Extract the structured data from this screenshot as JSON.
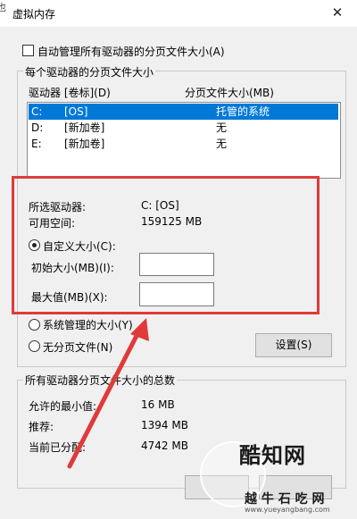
{
  "window": {
    "title": "虚拟内存",
    "close_glyph": "✕",
    "left_edge_char": "也"
  },
  "auto_manage": {
    "label": "自动管理所有驱动器的分页文件大小(A)",
    "checked": false
  },
  "drives_group": {
    "title": "每个驱动器的分页文件大小",
    "col_drive": "驱动器 [卷标](D)",
    "col_size": "分页文件大小(MB)",
    "rows": [
      {
        "drive": "C:",
        "label": "[OS]",
        "size": "托管的系统",
        "selected": true
      },
      {
        "drive": "D:",
        "label": "[新加卷]",
        "size": "无",
        "selected": false
      },
      {
        "drive": "E:",
        "label": "[新加卷]",
        "size": "无",
        "selected": false
      }
    ],
    "selected_drive_label": "所选驱动器:",
    "selected_drive_value": "C:  [OS]",
    "free_space_label": "可用空间:",
    "free_space_value": "159125 MB",
    "custom_size_label": "自定义大小(C):",
    "initial_size_label": "初始大小(MB)(I):",
    "initial_size_value": "",
    "max_size_label": "最大值(MB)(X):",
    "max_size_value": "",
    "system_managed_label": "系统管理的大小(Y)",
    "no_paging_label": "无分页文件(N)",
    "set_button": "设置(S)",
    "selected_option": "custom"
  },
  "total_group": {
    "title": "所有驱动器分页文件大小的总数",
    "min_allowed_label": "允许的最小值:",
    "min_allowed_value": "16 MB",
    "recommended_label": "推荐:",
    "recommended_value": "1394 MB",
    "current_label": "当前已分配:",
    "current_value": "4742 MB"
  },
  "annotation": {
    "color": "#e03a3a"
  },
  "watermark": {
    "brand": "酷知网",
    "sub": "越 牛 石 吃 网",
    "url": "www.yueyangbang.com"
  },
  "colors": {
    "selection": "#0078d7",
    "dialog_bg": "#f0f0f0",
    "annotation": "#e03a3a"
  }
}
